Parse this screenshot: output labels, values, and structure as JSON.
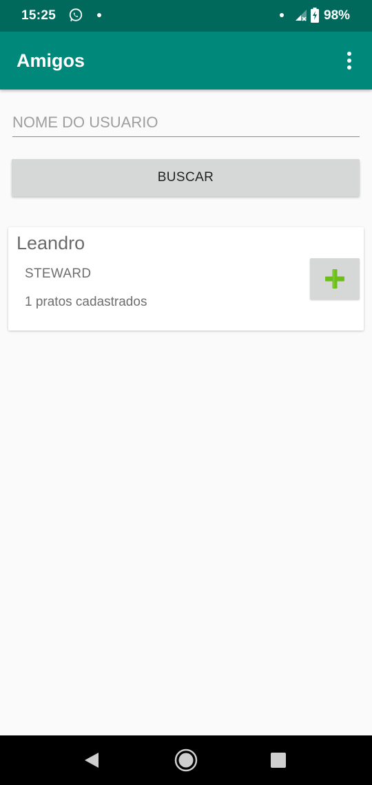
{
  "status_bar": {
    "time": "15:25",
    "battery": "98%",
    "icons": [
      "whatsapp-icon",
      "notification-dot-icon",
      "signal-icon",
      "battery-charging-icon"
    ]
  },
  "app_bar": {
    "title": "Amigos",
    "menu_icon": "more-vert-icon"
  },
  "search": {
    "placeholder": "NOME DO USUARIO",
    "value": "",
    "button_label": "BUSCAR"
  },
  "results": [
    {
      "name": "Leandro",
      "role": "STEWARD",
      "dishes": "1 pratos cadastrados",
      "action_icon": "plus-icon"
    }
  ],
  "nav_bar": {
    "icons": [
      "back-icon",
      "home-icon",
      "recents-icon"
    ]
  },
  "colors": {
    "status_bar": "#00695c",
    "app_bar": "#00897b",
    "plus_icon": "#6cbf1a",
    "button_bg": "#d6d7d7"
  }
}
